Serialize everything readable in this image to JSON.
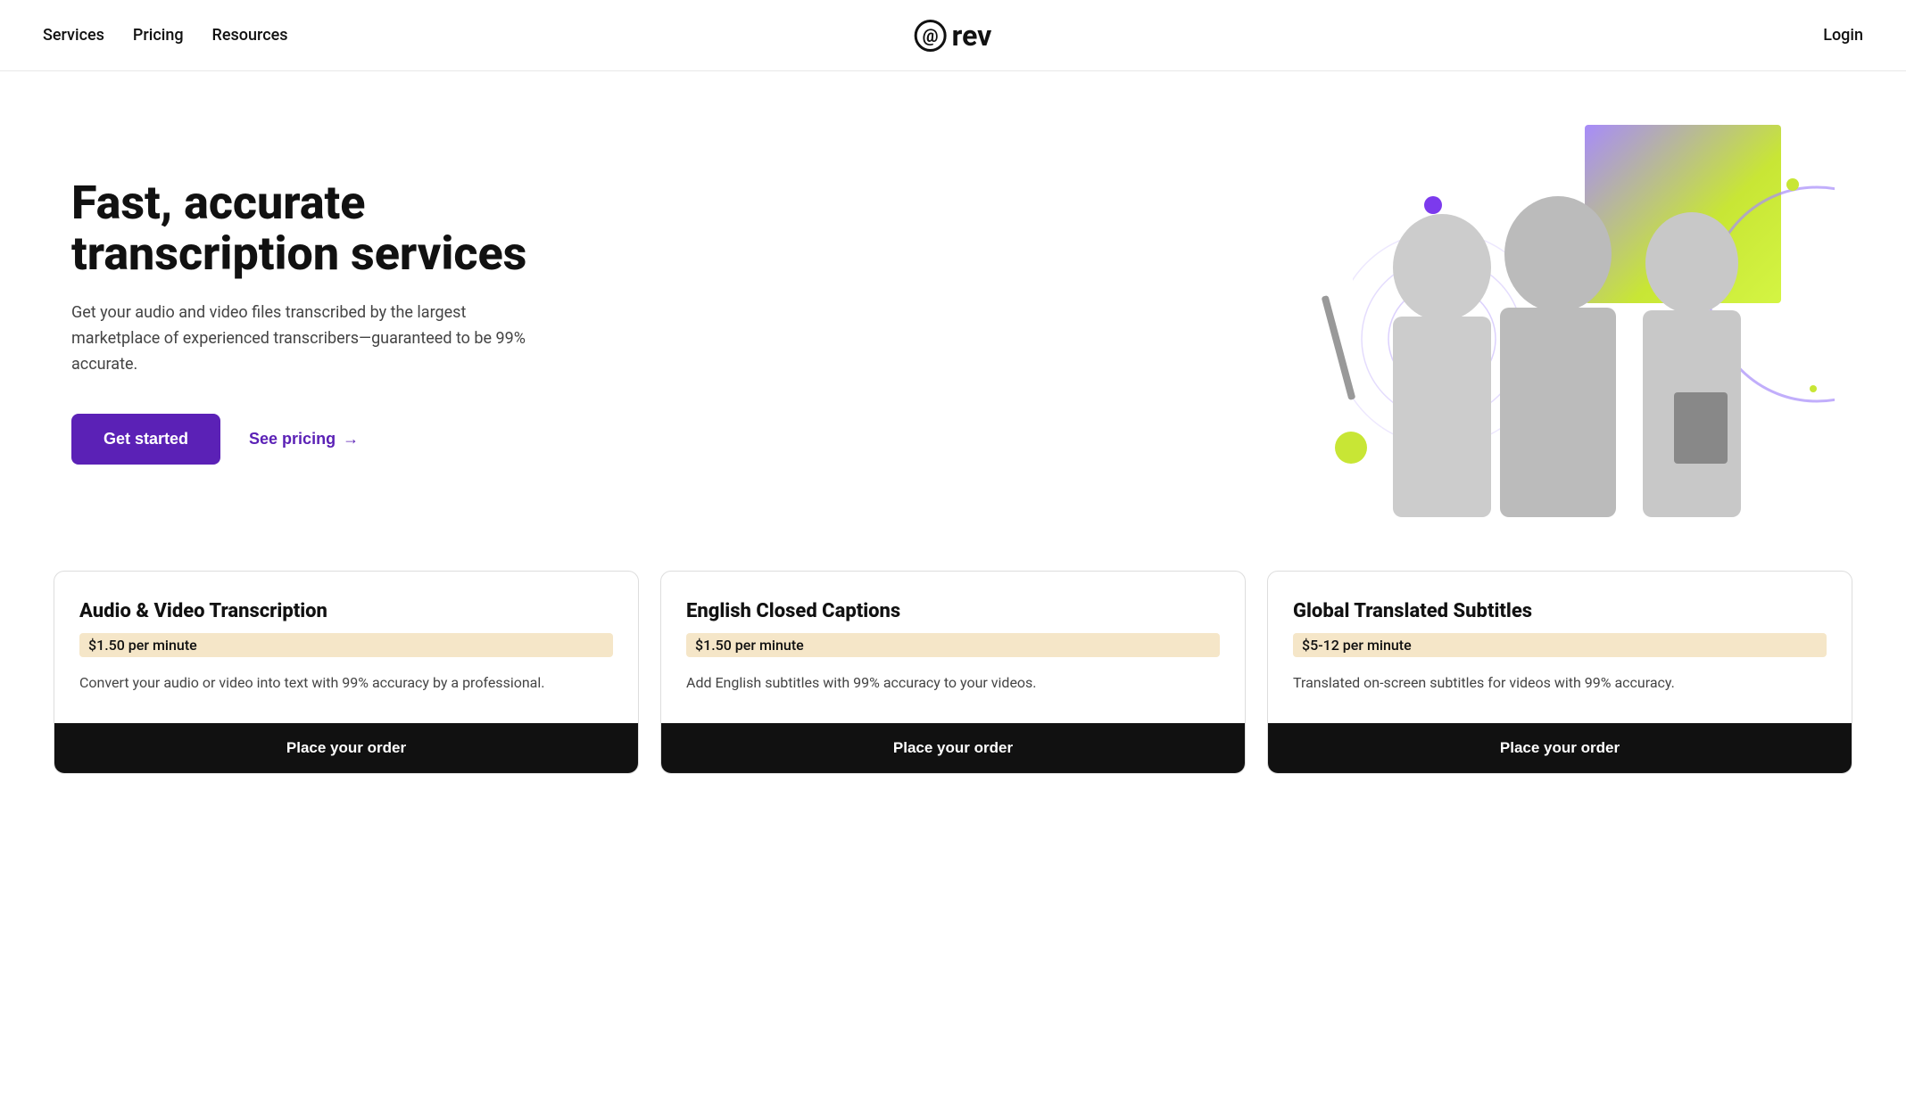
{
  "nav": {
    "items": [
      {
        "id": "services",
        "label": "Services"
      },
      {
        "id": "pricing",
        "label": "Pricing"
      },
      {
        "id": "resources",
        "label": "Resources"
      }
    ],
    "logo_at": "@",
    "logo_text": "rev",
    "login_label": "Login"
  },
  "hero": {
    "title": "Fast, accurate transcription services",
    "subtitle": "Get your audio and video files transcribed by the largest marketplace of experienced transcribers—guaranteed to be 99% accurate.",
    "cta_primary": "Get started",
    "cta_secondary": "See pricing",
    "cta_arrow": "→"
  },
  "services": [
    {
      "id": "audio-video",
      "title": "Audio & Video Transcription",
      "price": "$1.50 per minute",
      "description": "Convert your audio or video into text with 99% accuracy by a professional.",
      "cta": "Place your order"
    },
    {
      "id": "closed-captions",
      "title": "English Closed Captions",
      "price": "$1.50 per minute",
      "description": "Add English subtitles with 99% accuracy to your videos.",
      "cta": "Place your order"
    },
    {
      "id": "subtitles",
      "title": "Global Translated Subtitles",
      "price": "$5-12 per minute",
      "description": "Translated on-screen subtitles for videos with 99% accuracy.",
      "cta": "Place your order"
    }
  ]
}
